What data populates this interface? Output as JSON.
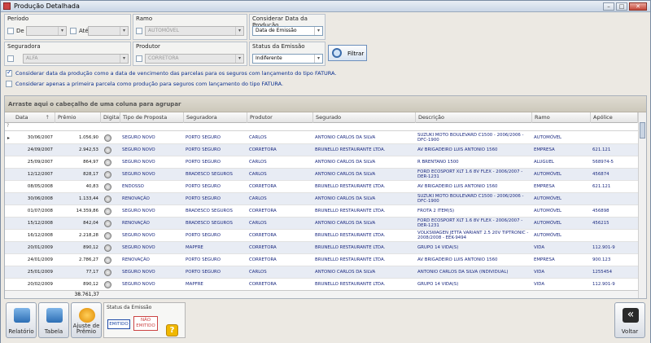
{
  "window": {
    "title": "Produção Detalhada",
    "minimize": "–",
    "maximize": "□",
    "close": "✕"
  },
  "filters": {
    "periodo_label": "Período",
    "de_label": "De",
    "ate_label": "Até",
    "ramo_label": "Ramo",
    "ramo_value": "AUTOMÓVEL",
    "considerar_data_label": "Considerar Data da Produção",
    "considerar_data_value": "Data de Emissão",
    "seguradora_label": "Seguradora",
    "seguradora_value": "ALFA",
    "produtor_label": "Produtor",
    "produtor_value": "CORRETORA",
    "status_emissao_label": "Status da Emissão",
    "status_emissao_value": "Indiferente",
    "filtrar_label": "Filtrar",
    "option1": "Considerar data da produção como a data de vencimento das parcelas para os seguros com lançamento do tipo FATURA.",
    "option1_checked": true,
    "option2": "Considerar apenas a primeira parcela como produção para seguros com lançamento do tipo FATURA.",
    "option2_checked": false
  },
  "grid": {
    "group_panel": "Arraste aqui o cabeçalho de uma coluna para agrupar",
    "filter_row_icon": "?",
    "headers": [
      "Data",
      "Prêmio",
      "Digital",
      "Tipo de Proposta",
      "Seguradora",
      "Produtor",
      "Segurado",
      "Descrição",
      "Ramo",
      "Apólice"
    ],
    "sort_icon": "↑",
    "current_row_indicator": "▸",
    "rows": [
      [
        "30/06/2007",
        "1.056,90",
        "SEGURO NOVO",
        "PORTO SEGURO",
        "CARLOS",
        "ANTONIO CARLOS DA SILVA",
        "SUZUKI MOTO BOULEVARD C1500 - 2006/2006 - DFC-1900",
        "AUTOMÓVEL",
        ""
      ],
      [
        "24/09/2007",
        "2.942,53",
        "SEGURO NOVO",
        "PORTO SEGURO",
        "CORRETORA",
        "BRUNELLO RESTAURANTE LTDA.",
        "AV BRIGADEIRO LUIS ANTONIO 1560",
        "EMPRESA",
        "621.121"
      ],
      [
        "25/09/2007",
        "864,97",
        "SEGURO NOVO",
        "PORTO SEGURO",
        "CARLOS",
        "ANTONIO CARLOS DA SILVA",
        "R BRENTANO 1500",
        "ALUGUEL",
        "568974-5"
      ],
      [
        "12/12/2007",
        "828,17",
        "SEGURO NOVO",
        "BRADESCO SEGUROS",
        "CARLOS",
        "ANTONIO CARLOS DA SILVA",
        "FORD ECOSPORT XLT 1.6 8V FLEX - 2006/2007 - DER-1231",
        "AUTOMÓVEL",
        "456874"
      ],
      [
        "08/05/2008",
        "40,83",
        "ENDOSSO",
        "PORTO SEGURO",
        "CORRETORA",
        "BRUNELLO RESTAURANTE LTDA.",
        "AV BRIGADEIRO LUIS ANTONIO 1560",
        "EMPRESA",
        "621.121"
      ],
      [
        "30/06/2008",
        "1.133,44",
        "RENOVAÇÃO",
        "PORTO SEGURO",
        "CARLOS",
        "ANTONIO CARLOS DA SILVA",
        "SUZUKI MOTO BOULEVARD C1500 - 2006/2006 - DFC-1900",
        "AUTOMÓVEL",
        ""
      ],
      [
        "01/07/2008",
        "14.359,86",
        "SEGURO NOVO",
        "BRADESCO SEGUROS",
        "CORRETORA",
        "BRUNELLO RESTAURANTE LTDA.",
        "FROTA 2 ITEM(S)",
        "AUTOMÓVEL",
        "456898"
      ],
      [
        "15/12/2008",
        "842,04",
        "RENOVAÇÃO",
        "BRADESCO SEGUROS",
        "CARLOS",
        "ANTONIO CARLOS DA SILVA",
        "FORD ECOSPORT XLT 1.6 8V FLEX - 2006/2007 - DER-1231",
        "AUTOMÓVEL",
        "456215"
      ],
      [
        "16/12/2008",
        "2.218,28",
        "SEGURO NOVO",
        "PORTO SEGURO",
        "CORRETORA",
        "BRUNELLO RESTAURANTE LTDA.",
        "VOLKSWAGEN JETTA VARIANT 2.5 20V TIPTRONIC - 2008/2008 - EEK-9494",
        "AUTOMÓVEL",
        ""
      ],
      [
        "20/01/2009",
        "890,12",
        "SEGURO NOVO",
        "MAPFRE",
        "CORRETORA",
        "BRUNELLO RESTAURANTE LTDA.",
        "GRUPO 14 VIDA(S)",
        "VIDA",
        "112.901-9"
      ],
      [
        "24/01/2009",
        "2.786,27",
        "RENOVAÇÃO",
        "PORTO SEGURO",
        "CORRETORA",
        "BRUNELLO RESTAURANTE LTDA.",
        "AV BRIGADEIRO LUIS ANTONIO 1560",
        "EMPRESA",
        "900.123"
      ],
      [
        "25/01/2009",
        "77,17",
        "SEGURO NOVO",
        "PORTO SEGURO",
        "CARLOS",
        "ANTONIO CARLOS DA SILVA",
        "ANTONIO CARLOS DA SILVA (INDIVIDUAL)",
        "VIDA",
        "1255454"
      ],
      [
        "20/02/2009",
        "890,12",
        "SEGURO NOVO",
        "MAPFRE",
        "CORRETORA",
        "BRUNELLO RESTAURANTE LTDA.",
        "GRUPO 14 VIDA(S)",
        "VIDA",
        "112.901-9"
      ]
    ],
    "total_premio": "38.761,37"
  },
  "bottom": {
    "relatorio": "Relatório",
    "tabela": "Tabela",
    "ajuste_premio": "Ajuste de Prêmio",
    "status_title": "Status da Emissão",
    "emitido": "EMITIDO",
    "nao_emitido": "NÃO EMITIDO",
    "help": "?",
    "voltar": "Voltar",
    "voltar_glyph": "«"
  }
}
